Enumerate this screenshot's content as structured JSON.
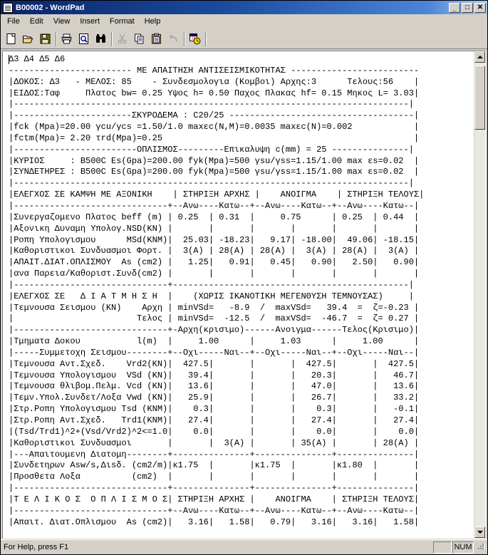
{
  "window": {
    "title": "B00002 - WordPad",
    "icon": "document-icon",
    "buttons": {
      "minimize": "_",
      "maximize": "□",
      "close": "✕"
    }
  },
  "menubar": {
    "items": [
      {
        "label": "File",
        "name": "menu-file"
      },
      {
        "label": "Edit",
        "name": "menu-edit"
      },
      {
        "label": "View",
        "name": "menu-view"
      },
      {
        "label": "Insert",
        "name": "menu-insert"
      },
      {
        "label": "Format",
        "name": "menu-format"
      },
      {
        "label": "Help",
        "name": "menu-help"
      }
    ]
  },
  "toolbar": {
    "items": [
      {
        "name": "new-document-icon",
        "tooltip": "New",
        "enabled": true
      },
      {
        "name": "open-folder-icon",
        "tooltip": "Open",
        "enabled": true
      },
      {
        "name": "save-floppy-icon",
        "tooltip": "Save",
        "enabled": true
      },
      {
        "name": "separator",
        "tooltip": "",
        "enabled": true
      },
      {
        "name": "print-icon",
        "tooltip": "Print",
        "enabled": true
      },
      {
        "name": "print-preview-icon",
        "tooltip": "Print Preview",
        "enabled": true
      },
      {
        "name": "find-binoculars-icon",
        "tooltip": "Find",
        "enabled": true
      },
      {
        "name": "separator",
        "tooltip": "",
        "enabled": true
      },
      {
        "name": "cut-scissors-icon",
        "tooltip": "Cut",
        "enabled": false
      },
      {
        "name": "copy-icon",
        "tooltip": "Copy",
        "enabled": true
      },
      {
        "name": "paste-clipboard-icon",
        "tooltip": "Paste",
        "enabled": true
      },
      {
        "name": "undo-arrow-icon",
        "tooltip": "Undo",
        "enabled": false
      },
      {
        "name": "separator",
        "tooltip": "",
        "enabled": true
      },
      {
        "name": "date-time-icon",
        "tooltip": "Date/Time",
        "enabled": true
      }
    ]
  },
  "document": {
    "text": "Δ3 Δ4 Δ5 Δ6\n------------------------ ΜΕ ΑΠΑΙΤΗΣΗ ΑΝΤΙΣΕΙΣΜΙΚΟΤΗΤΑΣ -------------------------\n|ΔΟΚΟΣ: Δ3   - ΜΕΛΟΣ: 85    - Συνδεσμολογια (Κομβοι) Αρχης:3      Τελους:56    |\n|ΕΙΔΟΣ:Ταφ     Πλατος bw= 0.25 Υψος h= 0.50 Παχος Πλακας hf= 0.15 Μηκος L= 3.03|\n|-----------------------------------------------------------------------------|\n|-----------------------ΣΚΥΡΟΔΕΜΑ : C20/25 ------------------------------------|\n|fck (Mpa)=20.00 γcu/γcs =1.50/1.0 maxεc(N,M)=0.0035 maxεc(N)=0.002            |\n|fctm(Mpa)= 2.20 τrd(Mpa)=0.25                                                 |\n|------------------------ΟΠΛΙΣΜΟΣ---------Επικαλυψη c(mm) = 25 ---------------|\n|ΚΥΡΙΟΣ     : B500C Es(Gpa)=200.00 fyk(Mpa)=500 γsu/γss=1.15/1.00 max εs=0.02  |\n|ΣΥΝΔΕΤΗΡΕΣ : B500C Es(Gpa)=200.00 fyk(Mpa)=500 γsu/γss=1.15/1.00 max εs=0.02  |\n|-----------------------------------------------------------------------------|\n|ΕΛΕΓΧΟΣ ΣΕ ΚΑΜΨΗ ΜΕ ΑΞΟΝΙΚΗ    | ΣΤΗΡΙΞΗ ΑΡΧΗΣ |    ΑΝΟΙΓΜΑ    | ΣΤΗΡΙΞΗ ΤΕΛΟΥΣ|\n|------------------------------+--Ανω----Κατω--+--Ανω----Κατω--+--Ανω----Κατω--|\n|Συνεργαζομενο Πλατος beff (m) | 0.25  | 0.31  |     0.75      | 0.25  | 0.44  |\n|Αξονικη Δυναμη Υπολογ.NSD(KN) |       |       |       |       |       |       |\n|Ροπη Υπολογισμου      MSd(KNM)|  25.03| -18.23|   9.17| -18.00|  49.06| -18.15|\n|Καθοριστικοι Συνδυασμοι Φορτ. |  3(A) | 28(A) | 28(A) |  3(A) | 28(A) |  3(A) |\n|ΑΠΑΙΤ.ΔΙΑΤ.ΟΠΛΙΣΜΟΥ  As (cm2) |   1.25|   0.91|   0.45|   0.90|   2.50|   0.90|\n|ανα Παρεια/Καθοριστ.Συνδ(cm2) |       |       |       |       |       |       |\n|------------------------------+----------------------------------------------|\n|ΕΛΕΓΧΟΣ ΣΕ   Δ Ι Α Τ Μ Η Σ Η  |    (ΧΩΡΙΣ ΙΚΑΝΟΤΙΚΗ ΜΕΓΕΝΘΥΣΗ ΤΕΜΝΟΥΣΑΣ)     |\n|Τεμνουσα Σεισμου (KN)    Αρχη | minVSd=   -8.9  /  maxVSd=   39.4  =  ζ=-0.23 |\n|                        Τελος | minVSd=  -12.5  /  maxVSd=  -46.7  =  ζ= 0.27 |\n|------------------------------+-Αρχη(κρισιμο)------Ανοιγμα------Τελος(Κρισιμο)|\n|Τμηματα Δοκου           l(m)  |     1.00      |     1.03      |     1.00      |\n|-----Συμμετοχη Σεισμου--------+--Οχι-----Ναι--+--Οχι-----Ναι--+--Οχι-----Ναι--|\n|Τεμνουσα Αντ.Σχεδ.    Vrd2(KN)|  427.5|       |       |  427.5|       |  427.5|\n|Τεμνουσα Υπολογισμου  VSd (KN)|   39.4|       |       |   20.3|       |   46.7|\n|Τεμνουσα θλιβομ.Πελμ. Vcd (KN)|   13.6|       |       |   47.0|       |   13.6|\n|Τεμν.Υπολ.Συνδετ/Λοξα Vwd (KN)|   25.9|       |       |   26.7|       |   33.2|\n|Στρ.Ροπη Υπολογισμου Tsd (KNM)|    0.3|       |       |    0.3|       |   -0.1|\n|Στρ.Ροπη Αντ.Σχεδ.   Trd1(KNM)|   27.4|       |       |   27.4|       |   27.4|\n|(Tsd/Trd1)^2+(Vsd/Vrd2)^2<=1.0|    0.0|       |       |    0.0|       |    0.0|\n|Καθοριστικοι Συνδυασμοι       |       |  3(A) |       | 35(A) |       | 28(A) |\n|---Απαιτουμενη Διατομη--------+---------------+---------------+---------------|\n|Συνδετηρων Asw/s,Διsδ. (cm2/m)|κ1.75  |       |κ1.75  |       |κ1.80  |       |\n|Προσθετα Λοξα          (cm2)  |       |       |       |       |       |       |\n|------------------------------+---------------+---------------+---------------|\n|Τ Ε Λ Ι Κ Ο Σ  Ο Π Λ Ι Σ Μ Ο Σ| ΣΤΗΡΙΞΗ ΑΡΧΗΣ |    ΑΝΟΙΓΜΑ    | ΣΤΗΡΙΞΗ ΤΕΛΟΥΣ|\n|------------------------------+--Ανω----Κατω--+--Ανω----Κατω--+--Ανω----Κατω--|\n|Απαιτ. Διατ.Οπλισμου  As (cm2)|   3.16|   1.58|   0.79|   3.16|   3.16|   1.58|"
  },
  "scrollbar": {
    "up_arrow": "scroll-up-arrow-icon",
    "down_arrow": "scroll-down-arrow-icon"
  },
  "statusbar": {
    "message": "For Help, press F1",
    "pane_blank": "",
    "pane_num": "NUM"
  },
  "colors": {
    "title_bar_start": "#0a246a",
    "title_bar_end": "#a6caf0",
    "window_face": "#d4d0c8",
    "document_bg": "#ffffff",
    "text": "#000000"
  }
}
